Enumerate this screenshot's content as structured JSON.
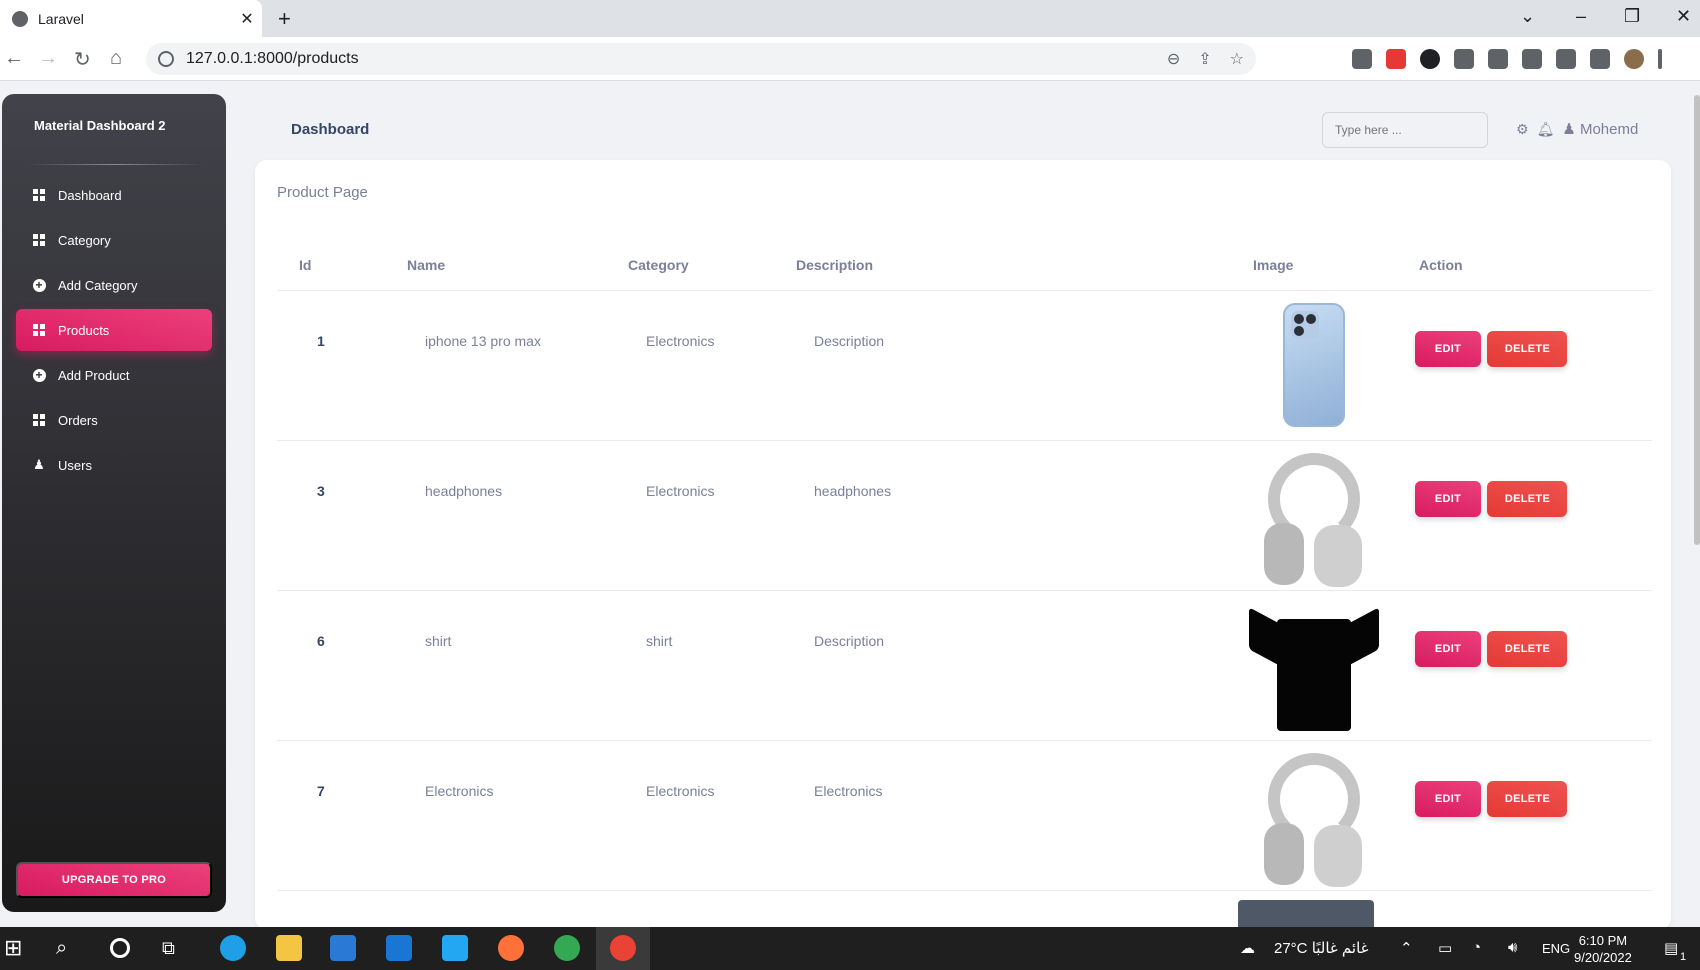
{
  "browser": {
    "tab_title": "Laravel",
    "url": "127.0.0.1:8000/products"
  },
  "sidebar": {
    "brand": "Material Dashboard 2",
    "items": [
      {
        "label": "Dashboard",
        "icon": "dashboard-icon"
      },
      {
        "label": "Category",
        "icon": "table-grid-icon"
      },
      {
        "label": "Add Category",
        "icon": "add-circle-icon"
      },
      {
        "label": "Products",
        "icon": "table-grid-icon",
        "active": true
      },
      {
        "label": "Add Product",
        "icon": "add-circle-icon"
      },
      {
        "label": "Orders",
        "icon": "table-grid-icon"
      },
      {
        "label": "Users",
        "icon": "person-icon"
      }
    ],
    "upgrade_label": "UPGRADE TO PRO"
  },
  "topnav": {
    "title": "Dashboard",
    "search_placeholder": "Type here ...",
    "user_name": "Mohemd"
  },
  "main": {
    "card_title": "Product Page",
    "columns": [
      "Id",
      "Name",
      "Category",
      "Description",
      "Image",
      "Action"
    ],
    "rows": [
      {
        "id": "1",
        "name": "iphone 13 pro max",
        "category": "Electronics",
        "description": "Description",
        "image": "iphone-image"
      },
      {
        "id": "3",
        "name": "headphones",
        "category": "Electronics",
        "description": "headphones",
        "image": "headphones-image"
      },
      {
        "id": "6",
        "name": "shirt",
        "category": "shirt",
        "description": "Description",
        "image": "shirt-image"
      },
      {
        "id": "7",
        "name": "Electronics",
        "category": "Electronics",
        "description": "Electronics",
        "image": "headphones-image"
      }
    ],
    "edit_label": "EDIT",
    "delete_label": "DELETE"
  },
  "taskbar": {
    "weather": "27°C  غائم غالبًا",
    "lang": "ENG",
    "time": "6:10 PM",
    "date": "9/20/2022",
    "notifications": "1"
  },
  "colors": {
    "accent": "#e91e63",
    "danger": "#f44335",
    "sidebar_dark": "#202024"
  }
}
